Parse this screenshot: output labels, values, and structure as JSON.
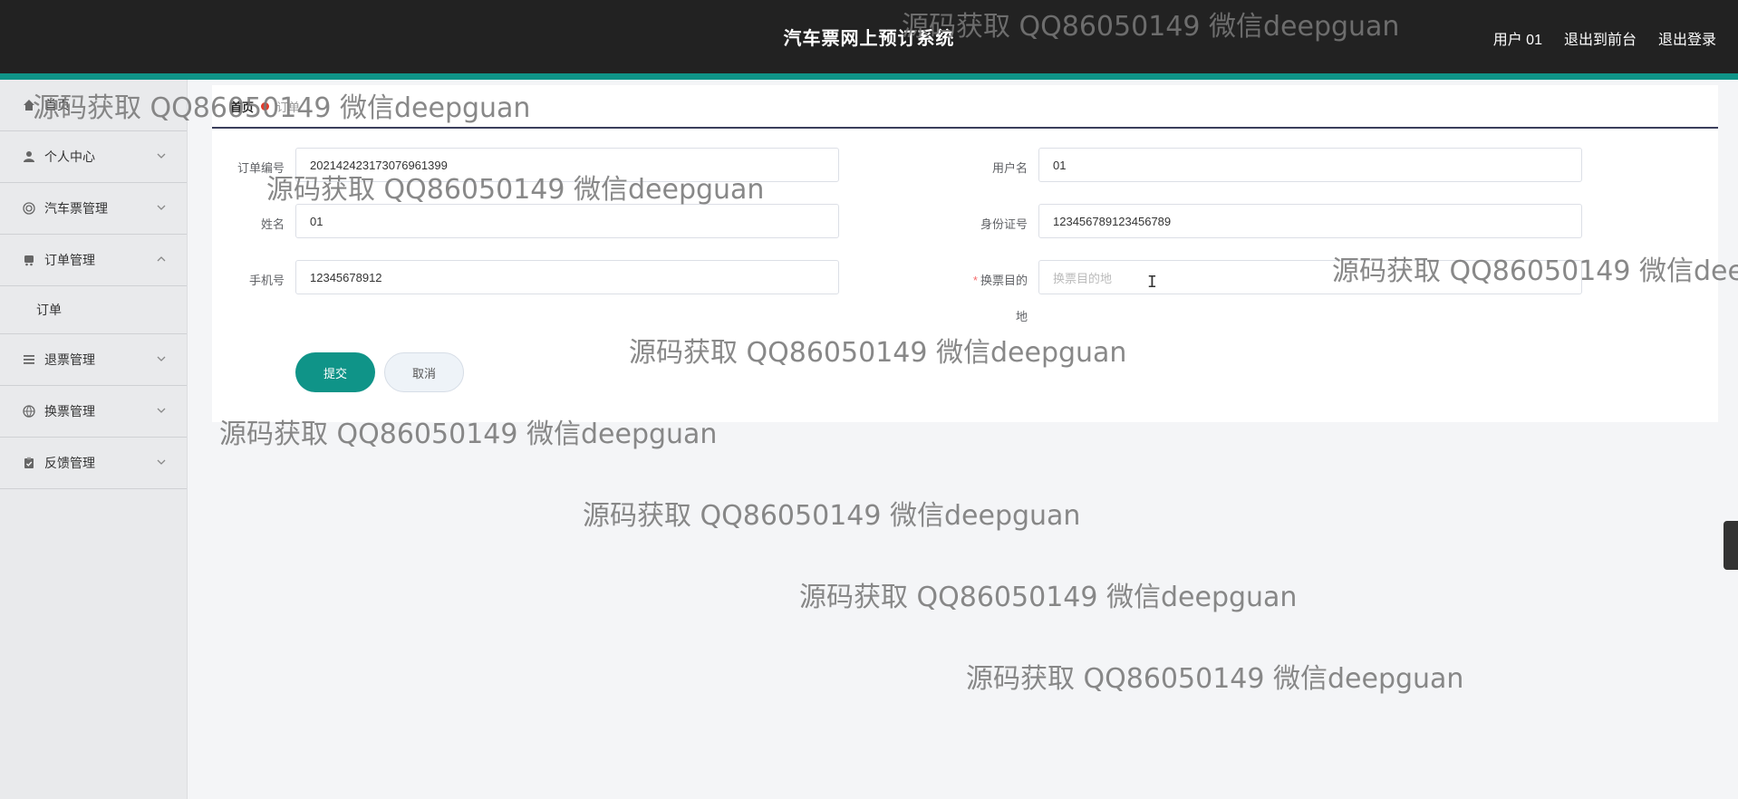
{
  "header": {
    "title": "汽车票网上预订系统",
    "links": [
      "用户 01",
      "退出到前台",
      "退出登录"
    ]
  },
  "sidebar": {
    "items": [
      {
        "label": "首页",
        "icon": "home-icon"
      },
      {
        "label": "个人中心",
        "icon": "user-icon"
      },
      {
        "label": "汽车票管理",
        "icon": "target-icon"
      },
      {
        "label": "订单管理",
        "icon": "bus-icon",
        "expanded": true
      },
      {
        "label": "退票管理",
        "icon": "list-icon"
      },
      {
        "label": "换票管理",
        "icon": "globe-icon"
      },
      {
        "label": "反馈管理",
        "icon": "clipboard-icon"
      }
    ],
    "sub_item": "订单"
  },
  "breadcrumb": {
    "home": "首页",
    "current": "订单"
  },
  "form": {
    "order_no_label": "订单编号",
    "order_no_value": "202142423173076961399",
    "username_label": "用户名",
    "username_value": "01",
    "name_label": "姓名",
    "name_value": "01",
    "id_label": "身份证号",
    "id_value": "123456789123456789",
    "phone_label": "手机号",
    "phone_value": "12345678912",
    "dest_label_line1": "换票目的",
    "dest_label_line2": "地",
    "dest_placeholder": "换票目的地",
    "submit": "提交",
    "cancel": "取消"
  },
  "watermark": "源码获取 QQ86050149 微信deepguan",
  "colors": {
    "accent": "#0f9488",
    "header": "#222222",
    "required": "#f56c6c"
  }
}
